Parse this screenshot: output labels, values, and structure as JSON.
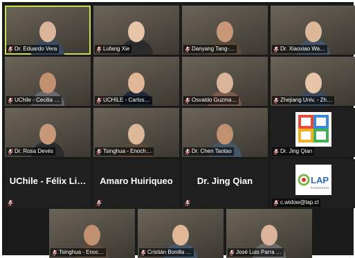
{
  "participants": [
    {
      "name": "Dr. Eduardo Vera",
      "kind": "video",
      "active": true
    },
    {
      "name": "Lufang Xie",
      "kind": "video"
    },
    {
      "name": "Danyang Tang-…",
      "kind": "video"
    },
    {
      "name": "Dr. Xiaoxiao Wa…",
      "kind": "video"
    },
    {
      "name": "UChile - Cecilia …",
      "kind": "video"
    },
    {
      "name": "UCHILE - Carlos…",
      "kind": "video"
    },
    {
      "name": "Osvaldo Guzma…",
      "kind": "video"
    },
    {
      "name": "Zhejiang Univ. - Zh…",
      "kind": "video"
    },
    {
      "name": "Dr. Rosa Devés",
      "kind": "video"
    },
    {
      "name": "Tsinghua - Enoch…",
      "kind": "video"
    },
    {
      "name": "Dr. Chen Taotao",
      "kind": "video"
    },
    {
      "name": "Dr. Jing Qian",
      "kind": "logo",
      "logo": "colorful-squares"
    },
    {
      "name": "",
      "kind": "text",
      "display_name": "UChile - Félix Li…"
    },
    {
      "name": "",
      "kind": "text",
      "display_name": "Amaro Huiriqueo"
    },
    {
      "name": "",
      "kind": "text",
      "display_name": "Dr. Jing Qian"
    },
    {
      "name": "c.widow@lap.cl",
      "kind": "logo",
      "logo": "LAP"
    },
    {
      "name": "Tsinghua - Enoc…",
      "kind": "video"
    },
    {
      "name": "Cristián Bonilla …",
      "kind": "video"
    },
    {
      "name": "José Luis Parra …",
      "kind": "video"
    }
  ],
  "lap_logo_text": "LAP",
  "lap_logo_sub": "FOUNDATION",
  "colors": {
    "active_border": "#c8e04a",
    "muted_mic": "#e04040"
  }
}
